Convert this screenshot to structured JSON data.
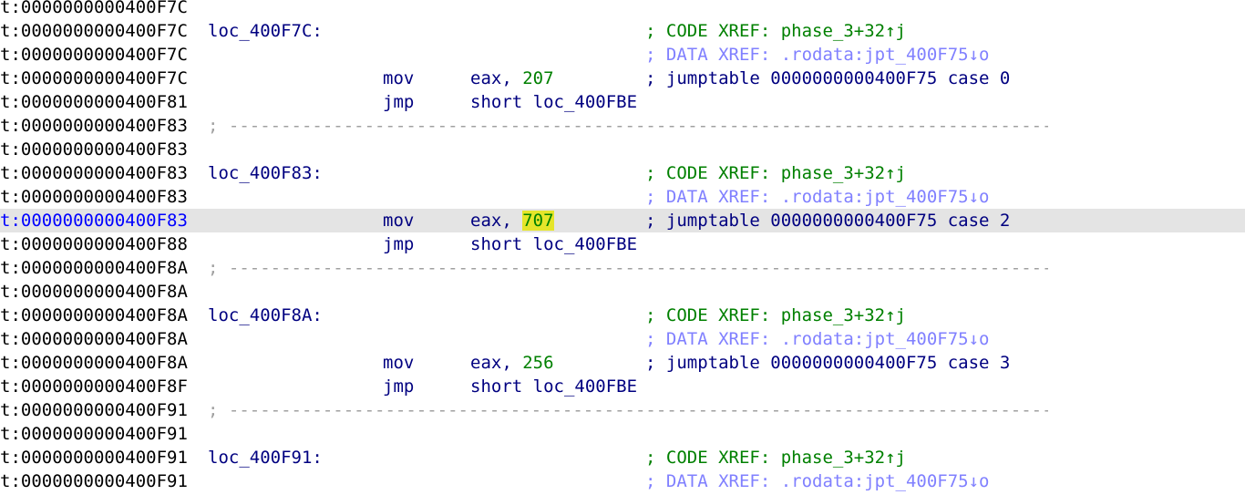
{
  "lines": [
    {
      "addr": "t:0000000000400F7C"
    },
    {
      "addr": "t:0000000000400F7C",
      "label": "loc_400F7C:",
      "comment": "; CODE XREF: phase_3+32↑j",
      "comment_kind": "code"
    },
    {
      "addr": "t:0000000000400F7C",
      "comment": "; DATA XREF: .rodata:jpt_400F75↓o",
      "comment_kind": "data"
    },
    {
      "addr": "t:0000000000400F7C",
      "mnemonic": "mov",
      "op_reg": "eax, ",
      "op_imm": "207",
      "comment": "; jumptable 0000000000400F75 case 0",
      "comment_kind": "jt"
    },
    {
      "addr": "t:0000000000400F81",
      "mnemonic": "jmp",
      "operand": "short loc_400FBE"
    },
    {
      "addr": "t:0000000000400F83",
      "separator": "; ------------------------------------------------------------------------------------------"
    },
    {
      "addr": "t:0000000000400F83"
    },
    {
      "addr": "t:0000000000400F83",
      "label": "loc_400F83:",
      "comment": "; CODE XREF: phase_3+32↑j",
      "comment_kind": "code"
    },
    {
      "addr": "t:0000000000400F83",
      "comment": "; DATA XREF: .rodata:jpt_400F75↓o",
      "comment_kind": "data"
    },
    {
      "addr": "t:0000000000400F83",
      "mnemonic": "mov",
      "op_reg": "eax, ",
      "op_imm": "707",
      "imm_highlight": true,
      "current": true,
      "comment": "; jumptable 0000000000400F75 case 2",
      "comment_kind": "jt"
    },
    {
      "addr": "t:0000000000400F88",
      "mnemonic": "jmp",
      "operand": "short loc_400FBE"
    },
    {
      "addr": "t:0000000000400F8A",
      "separator": "; ------------------------------------------------------------------------------------------"
    },
    {
      "addr": "t:0000000000400F8A"
    },
    {
      "addr": "t:0000000000400F8A",
      "label": "loc_400F8A:",
      "comment": "; CODE XREF: phase_3+32↑j",
      "comment_kind": "code"
    },
    {
      "addr": "t:0000000000400F8A",
      "comment": "; DATA XREF: .rodata:jpt_400F75↓o",
      "comment_kind": "data"
    },
    {
      "addr": "t:0000000000400F8A",
      "mnemonic": "mov",
      "op_reg": "eax, ",
      "op_imm": "256",
      "comment": "; jumptable 0000000000400F75 case 3",
      "comment_kind": "jt"
    },
    {
      "addr": "t:0000000000400F8F",
      "mnemonic": "jmp",
      "operand": "short loc_400FBE"
    },
    {
      "addr": "t:0000000000400F91",
      "separator": "; ------------------------------------------------------------------------------------------"
    },
    {
      "addr": "t:0000000000400F91"
    },
    {
      "addr": "t:0000000000400F91",
      "label": "loc_400F91:",
      "comment": "; CODE XREF: phase_3+32↑j",
      "comment_kind": "code"
    },
    {
      "addr": "t:0000000000400F91",
      "comment": "; DATA XREF: .rodata:jpt_400F75↓o",
      "comment_kind": "data"
    }
  ],
  "colors": {
    "address": "#000000",
    "current_address": "#0000ff",
    "current_line_bg": "#e4e4e4",
    "instruction": "#000080",
    "immediate": "#008000",
    "highlight": "#e5e52a",
    "code_xref": "#008000",
    "data_xref": "#8080ff",
    "separator": "#a0a0a0"
  }
}
